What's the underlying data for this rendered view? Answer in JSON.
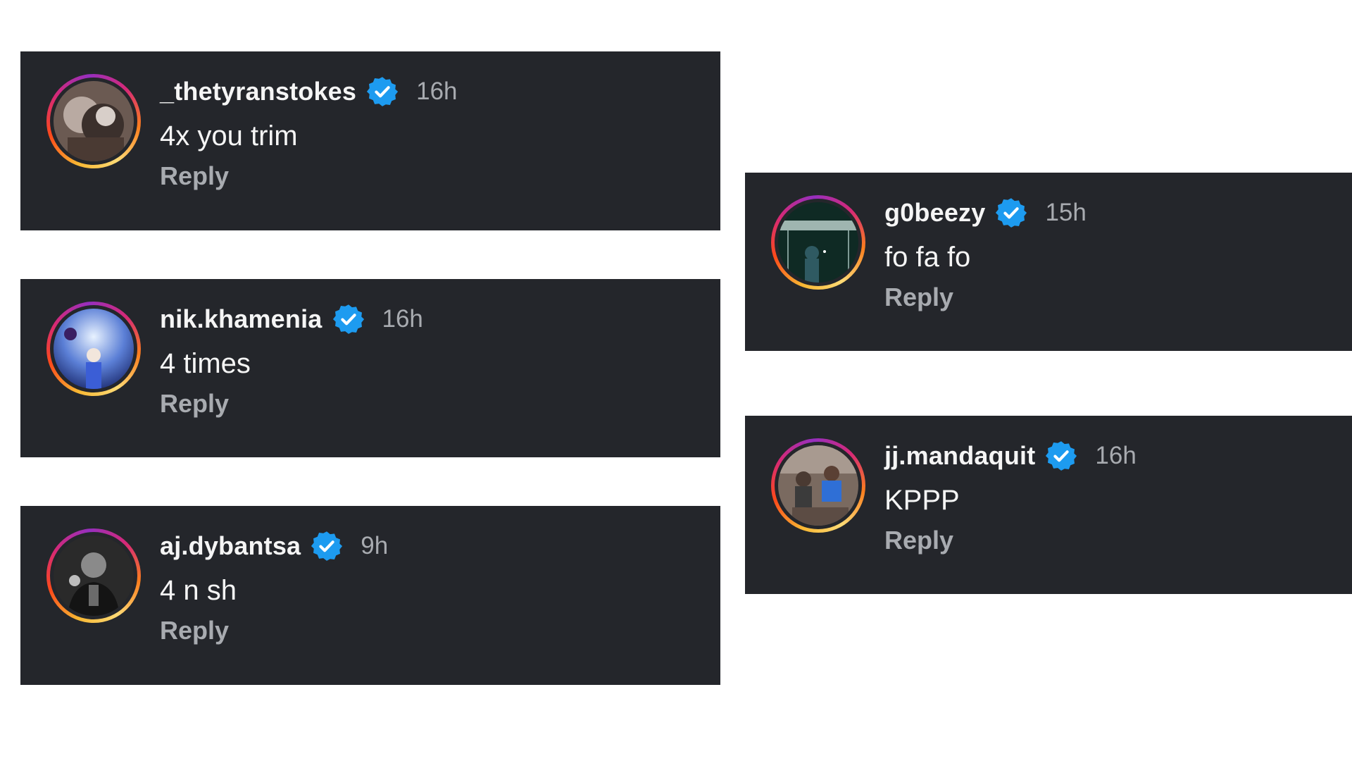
{
  "comments": [
    {
      "username": "_thetyranstokes",
      "verified": true,
      "timestamp": "16h",
      "text": "4x you trim",
      "reply_label": "Reply"
    },
    {
      "username": "nik.khamenia",
      "verified": true,
      "timestamp": "16h",
      "text": "4 times",
      "reply_label": "Reply"
    },
    {
      "username": "aj.dybantsa",
      "verified": true,
      "timestamp": "9h",
      "text": "4 n sh",
      "reply_label": "Reply"
    },
    {
      "username": "g0beezy",
      "verified": true,
      "timestamp": "15h",
      "text": "fo fa fo",
      "reply_label": "Reply"
    },
    {
      "username": "jj.mandaquit",
      "verified": true,
      "timestamp": "16h",
      "text": "KPPP",
      "reply_label": "Reply"
    }
  ],
  "colors": {
    "card_background": "#24262b",
    "page_background": "#ffffff",
    "primary_text": "#f5f5f5",
    "secondary_text": "#a8abb0",
    "verified_badge": "#1d9bf0"
  },
  "icons": {
    "verified": "verified-badge-icon",
    "avatar": "avatar-photo"
  }
}
